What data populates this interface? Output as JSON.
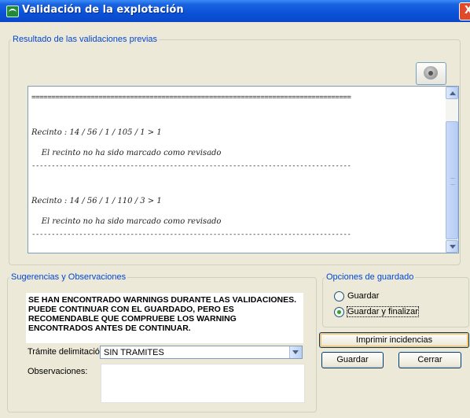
{
  "window": {
    "title": "Validación de la explotación",
    "close_glyph": "X"
  },
  "results_group": {
    "legend": "Resultado de las validaciones previas",
    "log_lines": [
      {
        "text": "=================================================================================",
        "kind": "sep"
      },
      {
        "text": "Recinto : 14 / 56 / 1 / 105 / 1 > 1",
        "kind": "text"
      },
      {
        "text": "    El recinto no ha sido marcado como revisado",
        "kind": "text"
      },
      {
        "text": "---------------------------------------------------------------------------------",
        "kind": "sep"
      },
      {
        "text": "Recinto : 14 / 56 / 1 / 110 / 3 > 1",
        "kind": "text"
      },
      {
        "text": "    El recinto no ha sido marcado como revisado",
        "kind": "text"
      },
      {
        "text": "---------------------------------------------------------------------------------",
        "kind": "sep"
      }
    ]
  },
  "suggestions_group": {
    "legend": "Sugerencias y Observaciones",
    "warning": "SE HAN ENCONTRADO WARNINGS DURANTE LAS VALIDACIONES. PUEDE CONTINUAR CON EL GUARDADO, PERO ES RECOMENDABLE QUE COMPRUEBE LOS WARNING ENCONTRADOS ANTES DE CONTINUAR.",
    "tramite_label": "Trámite delimitación:",
    "tramite_value": "SIN TRAMITES",
    "observaciones_label": "Observaciones:",
    "observaciones_value": ""
  },
  "save_options_group": {
    "legend": "Opciones de guardado",
    "options": [
      {
        "label": "Guardar",
        "selected": false
      },
      {
        "label": "Guardar y finalizar",
        "selected": true
      }
    ]
  },
  "buttons": {
    "print": "Imprimir incidencias",
    "save": "Guardar",
    "close": "Cerrar"
  },
  "icons": {
    "app": "junta-andalucia-app-icon",
    "delete": "trash-bin-icon"
  },
  "colors": {
    "titlebar": "#0a52d8",
    "legend_text": "#0046d5",
    "window_bg": "#ece9d8",
    "close_button": "#e04a2a",
    "radio_selected": "#2ba52b"
  }
}
